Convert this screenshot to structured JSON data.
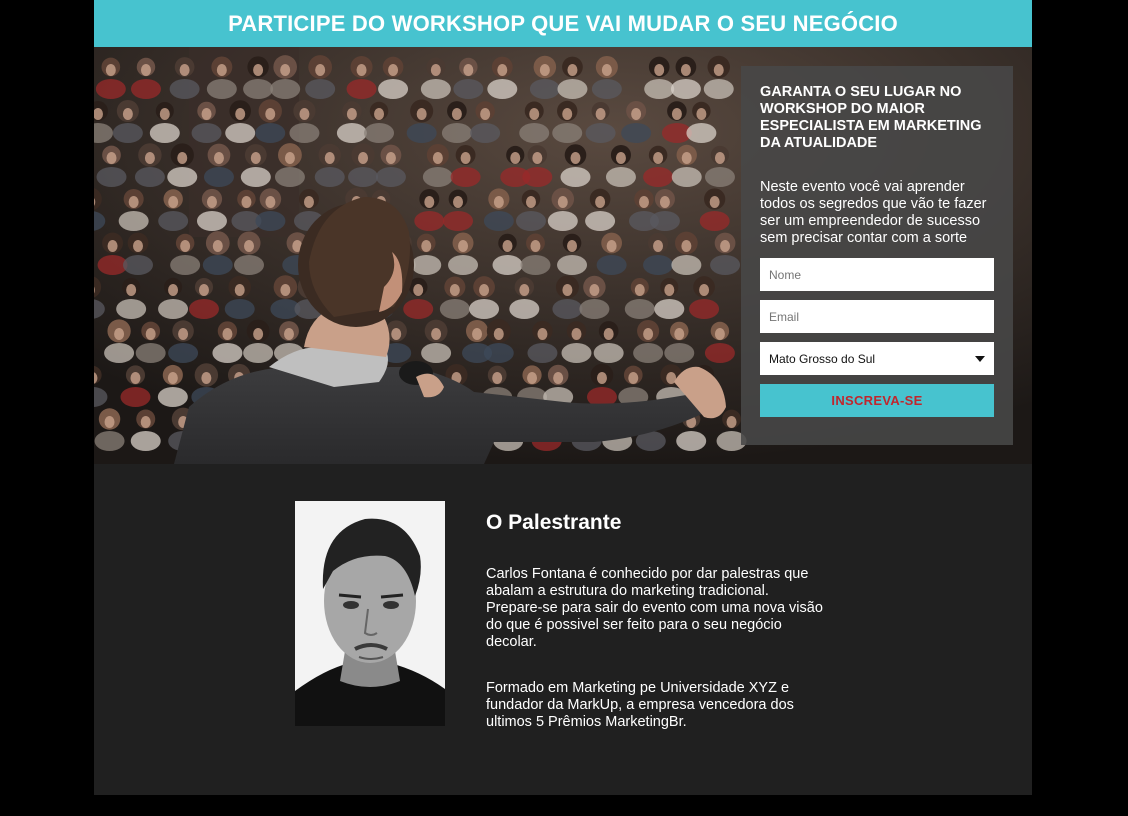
{
  "banner": {
    "title": "PARTICIPE DO WORKSHOP QUE VAI MUDAR O SEU NEGÓCIO"
  },
  "form": {
    "title": "GARANTA O SEU LUGAR NO WORKSHOP DO MAIOR ESPECIALISTA EM MARKETING DA ATUALIDADE",
    "description": "Neste evento você vai aprender todos os segredos que vão te fazer ser um empreendedor de sucesso sem precisar contar com a sorte",
    "name_placeholder": "Nome",
    "email_placeholder": "Email",
    "state_selected": "Mato Grosso do Sul",
    "submit_label": "INSCREVA-SE"
  },
  "speaker": {
    "heading": "O Palestrante",
    "bio_paragraph_1": "Carlos Fontana é conhecido por dar palestras que abalam a estrutura do marketing tradicional. Prepare-se para sair do evento com uma nova visão do que é possivel ser feito para o seu negócio decolar.",
    "bio_paragraph_2": "Formado em Marketing pe Universidade XYZ e fundador da MarkUp, a empresa vencedora dos ultimos 5 Prêmios MarketingBr."
  },
  "colors": {
    "accent": "#47c3cf",
    "submit_text": "#c0262d",
    "section_background": "#202020",
    "page_background": "#000000"
  }
}
